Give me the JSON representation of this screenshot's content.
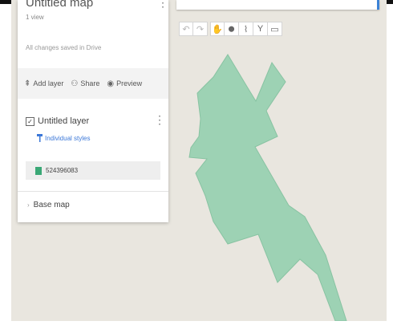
{
  "map": {
    "title": "Untitled map",
    "views": "1 view",
    "save_status": "All changes saved in Drive",
    "polygon_fill": "#9dd2b4",
    "polygon_stroke": "#88c3a2"
  },
  "actions": [
    {
      "icon": "add-layer-icon",
      "glyph": "⇞",
      "label": "Add layer"
    },
    {
      "icon": "share-icon",
      "glyph": "⚇",
      "label": "Share"
    },
    {
      "icon": "preview-icon",
      "glyph": "◉",
      "label": "Preview"
    }
  ],
  "layer": {
    "name": "Untitled layer",
    "checked": "✓",
    "style_label": "Individual styles",
    "feature_label": "524396083",
    "feature_color": "#3aa876"
  },
  "basemap": {
    "label": "Base map"
  },
  "toolbar": {
    "undo_glyph": "↶",
    "redo_glyph": "↷",
    "hand_glyph": "✋",
    "marker_glyph": "⬤",
    "line_glyph": "⌇",
    "directions_glyph": "Y",
    "ruler_glyph": "▭"
  },
  "kebab_glyph": "⋮",
  "chevron_glyph": "›"
}
